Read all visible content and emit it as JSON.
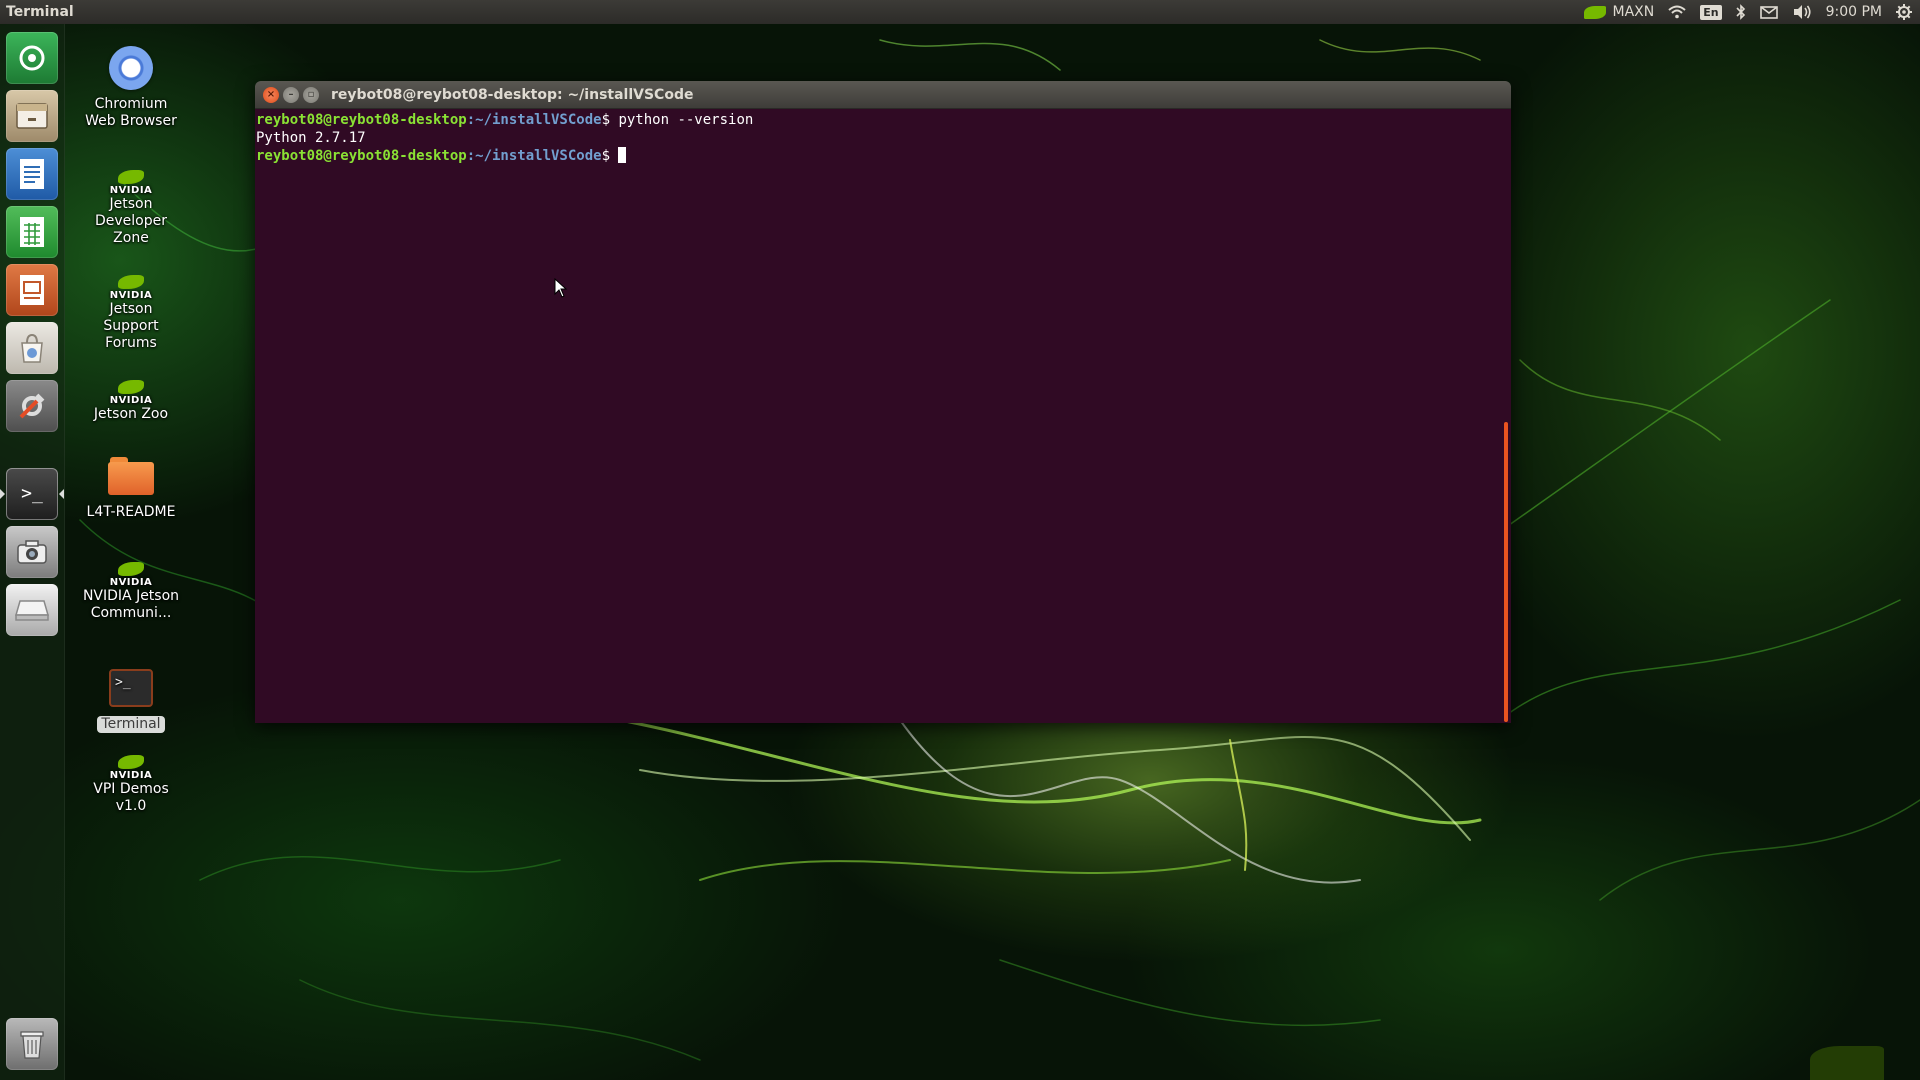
{
  "top_panel": {
    "app_title": "Terminal",
    "power_mode": "MAXN",
    "language": "En",
    "clock": "9:00 PM"
  },
  "launcher": {
    "items": [
      {
        "name": "Ubuntu Software Updater",
        "icon": "updater-icon",
        "color": "#1f8a3a"
      },
      {
        "name": "Files",
        "icon": "files-icon",
        "color": "#b5a48a"
      },
      {
        "name": "LibreOffice Writer",
        "icon": "writer-icon",
        "color": "#2f6db5"
      },
      {
        "name": "LibreOffice Calc",
        "icon": "calc-icon",
        "color": "#2f9a3a"
      },
      {
        "name": "LibreOffice Impress",
        "icon": "impress-icon",
        "color": "#c2572a"
      },
      {
        "name": "Ubuntu Software",
        "icon": "software-center-icon",
        "color": "#d9d6cf"
      },
      {
        "name": "System Settings",
        "icon": "settings-icon",
        "color": "#6e6e6e"
      },
      {
        "name": "Terminal",
        "icon": "terminal-icon",
        "color": "#2b2b2b"
      },
      {
        "name": "Screenshot",
        "icon": "camera-icon",
        "color": "#9b9b9b"
      },
      {
        "name": "Removable Drive",
        "icon": "drive-icon",
        "color": "#cfcfcf"
      },
      {
        "name": "Trash",
        "icon": "trash-icon",
        "color": "#8a8a8a"
      }
    ]
  },
  "desktop_icons": [
    {
      "label": "Chromium Web Browser",
      "icon": "chromium-icon"
    },
    {
      "label": "Jetson Developer Zone",
      "icon": "nvidia-icon"
    },
    {
      "label": "Jetson Support Forums",
      "icon": "nvidia-icon"
    },
    {
      "label": "Jetson Zoo",
      "icon": "nvidia-icon"
    },
    {
      "label": "L4T-README",
      "icon": "folder-icon"
    },
    {
      "label": "NVIDIA Jetson Communi...",
      "icon": "nvidia-icon"
    },
    {
      "label": "Terminal",
      "icon": "terminal-icon"
    },
    {
      "label": "VPI Demos v1.0",
      "icon": "nvidia-icon"
    }
  ],
  "nvidia_logo_text": "NVIDIA",
  "terminal": {
    "title": "reybot08@reybot08-desktop: ~/installVSCode",
    "prompt_user_host": "reybot08@reybot08-desktop",
    "prompt_path": ":~/installVSCode",
    "prompt_symbol": "$",
    "lines": [
      {
        "type": "prompt",
        "command": " python --version"
      },
      {
        "type": "output",
        "text": "Python 2.7.17"
      },
      {
        "type": "prompt",
        "command": " "
      }
    ]
  },
  "colors": {
    "terminal_bg": "#300a24",
    "prompt_user": "#8ae234",
    "prompt_path": "#729fcf",
    "accent": "#e95420",
    "nvidia_green": "#76b900"
  }
}
